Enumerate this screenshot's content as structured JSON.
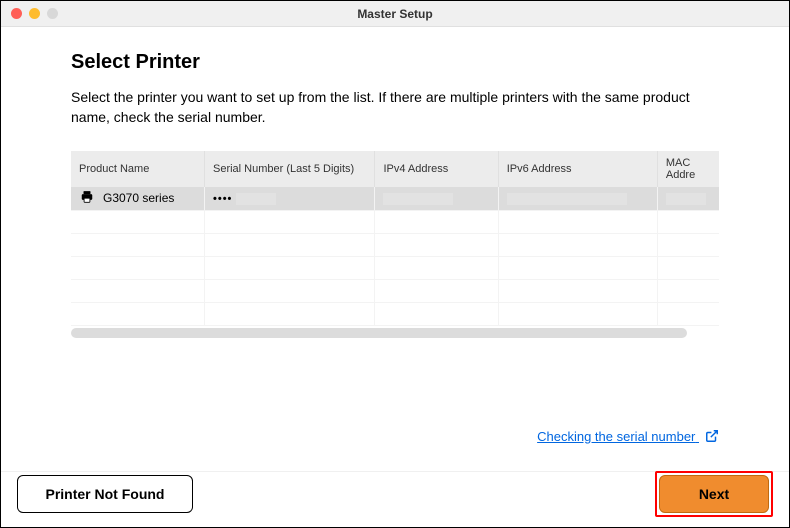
{
  "window": {
    "title": "Master Setup"
  },
  "page": {
    "title": "Select Printer",
    "description": "Select the printer you want to set up from the list. If there are multiple printers with the same product name, check the serial number."
  },
  "table": {
    "headers": {
      "product": "Product Name",
      "serial": "Serial Number (Last 5 Digits)",
      "ipv4": "IPv4 Address",
      "ipv6": "IPv6 Address",
      "mac": "MAC Addre"
    },
    "rows": [
      {
        "product": "G3070 series",
        "serial_prefix": "••••",
        "serial_rest": "",
        "ipv4": "",
        "ipv6": "",
        "mac": "",
        "selected": true
      }
    ]
  },
  "links": {
    "checking_serial": "Checking the serial number"
  },
  "buttons": {
    "not_found": "Printer Not Found",
    "next": "Next"
  },
  "icons": {
    "printer": "printer-icon",
    "external": "external-link-icon"
  }
}
